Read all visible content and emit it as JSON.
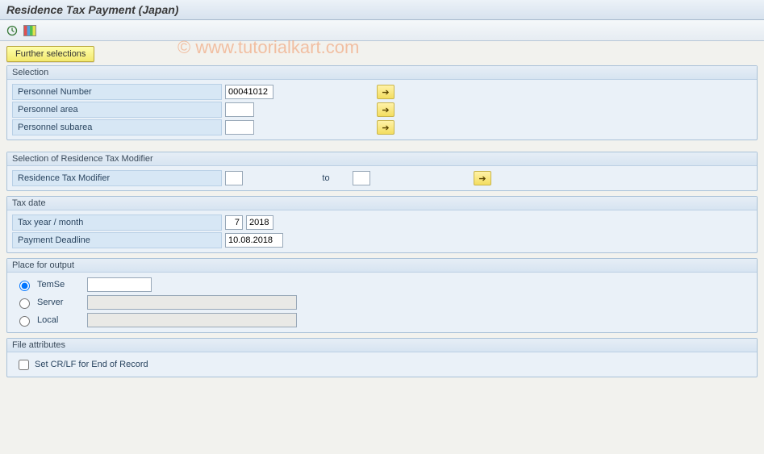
{
  "title": "Residence Tax Payment (Japan)",
  "watermark": "© www.tutorialkart.com",
  "toolbar": {
    "further_selections": "Further selections"
  },
  "groups": {
    "selection": {
      "title": "Selection",
      "rows": {
        "personnel_number": {
          "label": "Personnel Number",
          "value": "00041012"
        },
        "personnel_area": {
          "label": "Personnel area",
          "value": ""
        },
        "personnel_subarea": {
          "label": "Personnel subarea",
          "value": ""
        }
      }
    },
    "tax_modifier": {
      "title": "Selection of Residence Tax Modifier",
      "row": {
        "label": "Residence Tax Modifier",
        "from": "",
        "to_label": "to",
        "to": ""
      }
    },
    "tax_date": {
      "title": "Tax date",
      "tax_year_month": {
        "label": "Tax year / month",
        "month": "7",
        "year": "2018"
      },
      "payment_deadline": {
        "label": "Payment Deadline",
        "value": "10.08.2018"
      }
    },
    "output": {
      "title": "Place for output",
      "options": {
        "temse": {
          "label": "TemSe",
          "value": "",
          "selected": true
        },
        "server": {
          "label": "Server",
          "value": "",
          "selected": false
        },
        "local": {
          "label": "Local",
          "value": "",
          "selected": false
        }
      }
    },
    "file_attr": {
      "title": "File attributes",
      "crlf": {
        "label": "Set CR/LF for End of Record",
        "checked": false
      }
    }
  }
}
